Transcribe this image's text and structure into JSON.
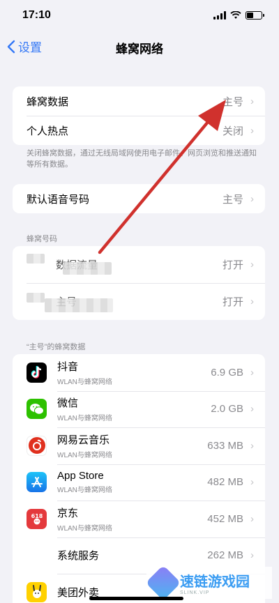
{
  "status": {
    "time": "17:10"
  },
  "nav": {
    "back_label": "设置",
    "title": "蜂窝网络"
  },
  "group1": {
    "rows": [
      {
        "label": "蜂窝数据",
        "value": "主号"
      },
      {
        "label": "个人热点",
        "value": "关闭"
      }
    ]
  },
  "footnote": "关闭蜂窝数据，通过无线局域网使用电子邮件、网页浏览和推送通知等所有数据。",
  "group2": {
    "label": "默认语音号码",
    "value": "主号"
  },
  "section_numbers": "蜂窝号码",
  "group3": {
    "rows": [
      {
        "label": "数据流量",
        "value": "打开"
      },
      {
        "label": "主号",
        "value": "打开"
      }
    ]
  },
  "section_apps": "“主号”的蜂窝数据",
  "apps": [
    {
      "name": "抖音",
      "sub": "WLAN与蜂窝网络",
      "size": "6.9 GB",
      "icon": "douyin-icon"
    },
    {
      "name": "微信",
      "sub": "WLAN与蜂窝网络",
      "size": "2.0 GB",
      "icon": "wechat-icon"
    },
    {
      "name": "网易云音乐",
      "sub": "WLAN与蜂窝网络",
      "size": "633 MB",
      "icon": "netease-music-icon"
    },
    {
      "name": "App Store",
      "sub": "WLAN与蜂窝网络",
      "size": "482 MB",
      "icon": "app-store-icon"
    },
    {
      "name": "京东",
      "sub": "WLAN与蜂窝网络",
      "size": "452 MB",
      "icon": "jd-icon"
    },
    {
      "name": "系统服务",
      "sub": "",
      "size": "262 MB",
      "icon": ""
    },
    {
      "name": "美团外卖",
      "sub": "",
      "size": "",
      "icon": "meituan-icon"
    }
  ],
  "watermark": {
    "title": "速链游戏园",
    "sub": "SLINK.VIP"
  },
  "colors": {
    "accent": "#3478f6",
    "arrow": "#d0312d"
  }
}
